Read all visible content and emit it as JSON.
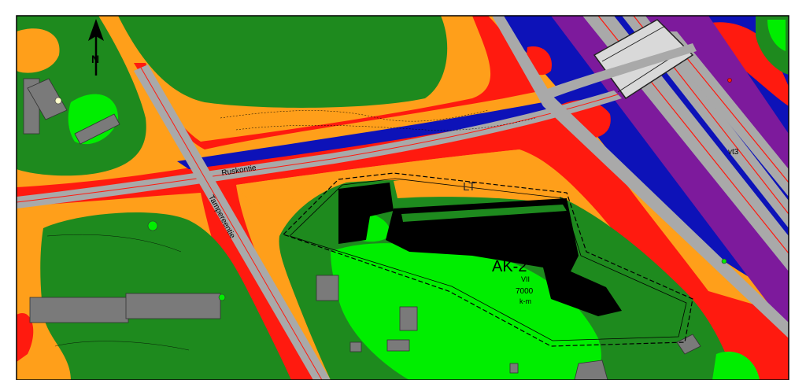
{
  "map": {
    "labels": {
      "road_ruskontie": "Ruskontie",
      "road_tampereentie": "Tampereentie",
      "road_vt3": "vt3",
      "zone_lt": "LT",
      "zone_ak2": "AK-2",
      "zone_floors": "VII",
      "zone_area": "7000",
      "zone_unit": "k-m",
      "north_letter": "N"
    },
    "legend_colors": {
      "dark_green": "#1e8a1e",
      "light_green": "#00ee00",
      "orange": "#ff9f1a",
      "red": "#ff1a0f",
      "blue": "#0d12b8",
      "purple": "#7d1a9c",
      "road_gray": "#a9a9a9",
      "building_gray": "#7a7a7a",
      "new_building_black": "#000000"
    }
  }
}
